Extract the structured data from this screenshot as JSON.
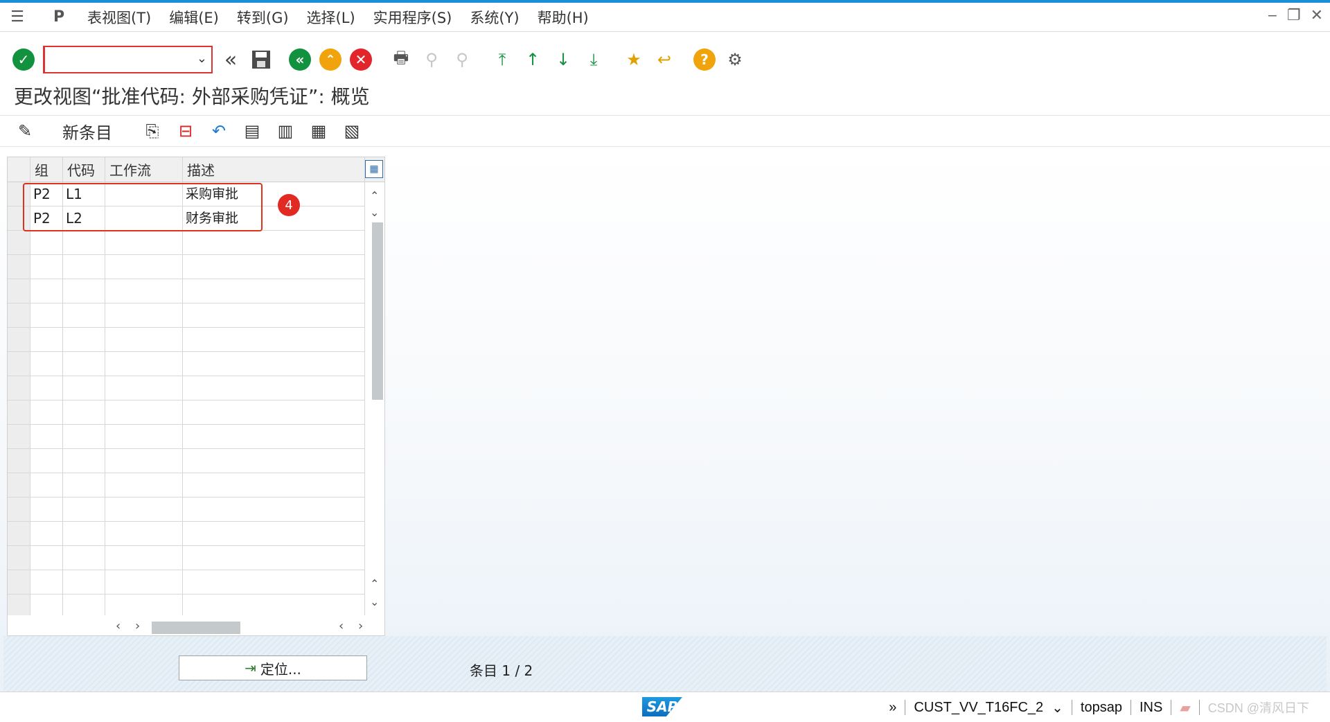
{
  "menubar": {
    "items": [
      "表视图(T)",
      "编辑(E)",
      "转到(G)",
      "选择(L)",
      "实用程序(S)",
      "系统(Y)",
      "帮助(H)"
    ]
  },
  "toolbar": {
    "command_value": "",
    "icons": [
      "enter-icon",
      "command-field",
      "collapse-icon",
      "save-icon",
      "back-icon",
      "exit-icon",
      "cancel-icon",
      "print-icon",
      "find-icon",
      "find-next-icon",
      "first-page-icon",
      "previous-page-icon",
      "next-page-icon",
      "last-page-icon",
      "create-session-icon",
      "shortcut-icon",
      "help-icon",
      "customize-layout-icon"
    ]
  },
  "title": "更改视图“批准代码: 外部采购凭证”: 概览",
  "app_toolbar": {
    "new_entries": "新条目"
  },
  "table": {
    "headers": [
      "组",
      "代码",
      "工作流",
      "描述"
    ],
    "rows": [
      {
        "group": "P2",
        "code": "L1",
        "workflow": "",
        "desc": "采购审批"
      },
      {
        "group": "P2",
        "code": "L2",
        "workflow": "",
        "desc": "财务审批"
      }
    ]
  },
  "annotation_badge": "4",
  "position_button": "定位...",
  "entry_info": {
    "label": "条目",
    "value": "1 / 2"
  },
  "statusbar": {
    "transaction": "CUST_VV_T16FC_2",
    "server": "topsap",
    "mode": "INS",
    "watermark": "CSDN @清风日下"
  },
  "colors": {
    "accent": "#1a8fd6",
    "highlight": "#e0301e",
    "green": "#12913e",
    "orange": "#f0a30a",
    "red": "#e1252b"
  }
}
